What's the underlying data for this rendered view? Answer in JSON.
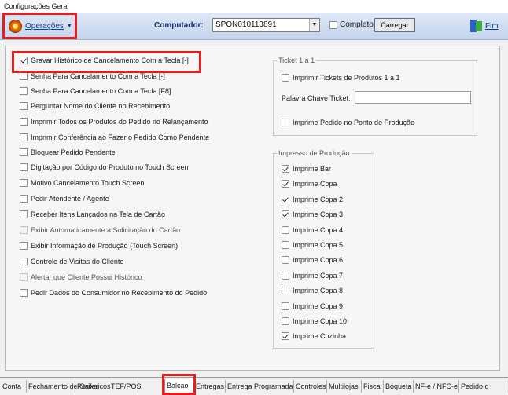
{
  "window": {
    "title": "Configurações Geral"
  },
  "toolbar": {
    "operacoes_label": "Operações",
    "computador_label": "Computador:",
    "computador_value": "SPON010113891",
    "completo_label": "Completo",
    "carregar_label": "Carregar",
    "fim_label": "Fim"
  },
  "options_left": [
    {
      "label": "Gravar Histórico de Cancelamento Com a Tecla [-]",
      "checked": true
    },
    {
      "label": "Senha Para Cancelamento Com a Tecla [-]",
      "checked": false
    },
    {
      "label": "Senha Para Cancelamento Com a Tecla [F8]",
      "checked": false
    },
    {
      "label": "Perguntar Nome do Cliente no Recebimento",
      "checked": false
    },
    {
      "label": "Imprimir Todos os Produtos do Pedido no Relançamento",
      "checked": false
    },
    {
      "label": "Imprimir Conferência ao Fazer o Pedido Como Pendente",
      "checked": false
    },
    {
      "label": "Bloquear Pedido Pendente",
      "checked": false
    },
    {
      "label": "Digitação por Código do Produto no Touch Screen",
      "checked": false
    },
    {
      "label": "Motivo Cancelamento Touch Screen",
      "checked": false
    },
    {
      "label": "Pedir Atendente / Agente",
      "checked": false
    },
    {
      "label": "Receber Itens Lançados na Tela de Cartão",
      "checked": false
    },
    {
      "label": "Exibir Automaticamente a Solicitação do Cartão",
      "checked": false,
      "disabled": true
    },
    {
      "label": "Exibir Informação de Produção (Touch Screen)",
      "checked": false
    },
    {
      "label": "Controle de Visitas do Cliente",
      "checked": false
    },
    {
      "label": "Alertar que Cliente Possui Histórico",
      "checked": false,
      "disabled": true
    },
    {
      "label": "Pedir Dados do Consumidor no Recebimento do Pedido",
      "checked": false
    }
  ],
  "ticket_group": {
    "title": "Ticket 1 a 1",
    "imprimir_tickets_label": "Imprimir Tickets de Produtos 1 a 1",
    "palavra_chave_label": "Palavra Chave Ticket:",
    "palavra_chave_value": "",
    "imprime_pedido_label": "Imprime Pedido no Ponto de Produção"
  },
  "impresso_group": {
    "title": "Impresso de Produção",
    "items": [
      {
        "label": "Imprime Bar",
        "checked": true
      },
      {
        "label": "Imprime Copa",
        "checked": true
      },
      {
        "label": "Imprime Copa 2",
        "checked": true
      },
      {
        "label": "Imprime Copa 3",
        "checked": true
      },
      {
        "label": "Imprime Copa 4",
        "checked": false
      },
      {
        "label": "Imprime Copa 5",
        "checked": false
      },
      {
        "label": "Imprime Copa 6",
        "checked": false
      },
      {
        "label": "Imprime Copa 7",
        "checked": false
      },
      {
        "label": "Imprime Copa 8",
        "checked": false
      },
      {
        "label": "Imprime Copa 9",
        "checked": false
      },
      {
        "label": "Imprime Copa 10",
        "checked": false
      },
      {
        "label": "Imprime Cozinha",
        "checked": true
      }
    ]
  },
  "tabs": [
    {
      "label": "Conta"
    },
    {
      "label": "Fechamento de Caixa"
    },
    {
      "label": "Perifericos"
    },
    {
      "label": "TEF/POS"
    },
    {
      "label": "Balcao",
      "active": true
    },
    {
      "label": "Entregas"
    },
    {
      "label": "Entrega Programada"
    },
    {
      "label": "Controles"
    },
    {
      "label": "Multilojas"
    },
    {
      "label": "Fiscal"
    },
    {
      "label": "Boqueta"
    },
    {
      "label": "NF-e / NFC-e"
    },
    {
      "label": "Pedido d"
    }
  ]
}
